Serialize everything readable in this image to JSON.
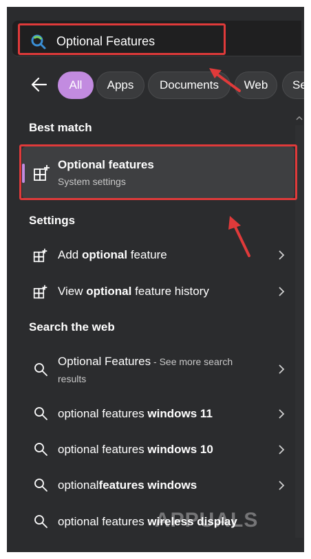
{
  "search": {
    "query": "Optional Features"
  },
  "filters": [
    {
      "label": "All",
      "active": true
    },
    {
      "label": "Apps",
      "active": false
    },
    {
      "label": "Documents",
      "active": false
    },
    {
      "label": "Web",
      "active": false
    },
    {
      "label": "Se",
      "active": false
    }
  ],
  "best_match": {
    "heading": "Best match",
    "title": "Optional features",
    "subtitle": "System settings"
  },
  "settings": {
    "heading": "Settings",
    "items": [
      {
        "pre": "Add ",
        "bold": "optional",
        "post": " feature"
      },
      {
        "pre": "View ",
        "bold": "optional",
        "post": " feature history"
      }
    ]
  },
  "web": {
    "heading": "Search the web",
    "items": [
      {
        "main": "Optional Features",
        "suffix": " - See more search",
        "line2": "results"
      },
      {
        "pre": "optional features ",
        "bold": "windows 11"
      },
      {
        "pre": "optional features ",
        "bold": "windows 10"
      },
      {
        "pre": "optional",
        "bold": "features windows"
      },
      {
        "pre": "optional features ",
        "bold": "wireless display"
      }
    ]
  },
  "watermark": "APPUALS",
  "colors": {
    "accent": "#c28be0",
    "highlight_outline": "#e03a3a",
    "panel_bg": "#2b2c2e"
  },
  "icons": {
    "search": "search-icon",
    "back": "back-arrow-icon",
    "settings_item": "add-grid-icon",
    "web_item": "magnifier-icon",
    "chevron": "chevron-right-icon"
  }
}
